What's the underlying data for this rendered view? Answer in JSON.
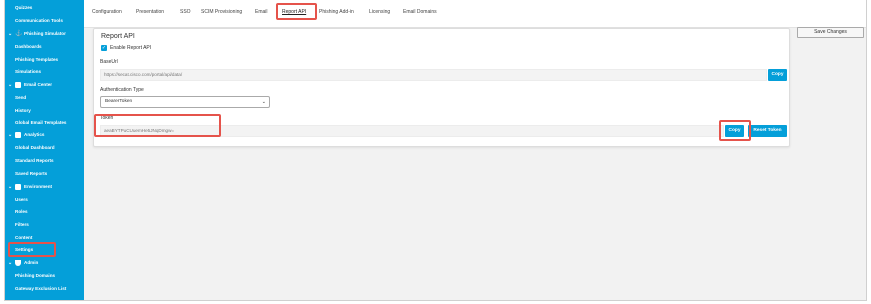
{
  "sidebar": {
    "items": [
      {
        "label": "Quizzes",
        "type": "sub"
      },
      {
        "label": "Communication Tools",
        "type": "sub"
      },
      {
        "label": "Phishing Simulator",
        "type": "group",
        "icon": "hook-icon"
      },
      {
        "label": "Dashboards",
        "type": "sub"
      },
      {
        "label": "Phishing Templates",
        "type": "sub"
      },
      {
        "label": "Simulations",
        "type": "sub"
      },
      {
        "label": "Email Center",
        "type": "group",
        "icon": "mail-icon"
      },
      {
        "label": "Send",
        "type": "sub"
      },
      {
        "label": "History",
        "type": "sub"
      },
      {
        "label": "Global Email Templates",
        "type": "sub"
      },
      {
        "label": "Analytics",
        "type": "group",
        "icon": "chart-icon"
      },
      {
        "label": "Global Dashboard",
        "type": "sub"
      },
      {
        "label": "Standard Reports",
        "type": "sub"
      },
      {
        "label": "Saved Reports",
        "type": "sub"
      },
      {
        "label": "Environment",
        "type": "group",
        "icon": "building-icon"
      },
      {
        "label": "Users",
        "type": "sub"
      },
      {
        "label": "Roles",
        "type": "sub"
      },
      {
        "label": "Filters",
        "type": "sub"
      },
      {
        "label": "Content",
        "type": "sub"
      },
      {
        "label": "Settings",
        "type": "sub"
      },
      {
        "label": "Admin",
        "type": "group",
        "icon": "shield-icon"
      },
      {
        "label": "Phishing Domains",
        "type": "sub"
      },
      {
        "label": "Gateway Exclusion List",
        "type": "sub"
      }
    ]
  },
  "tabs": [
    {
      "label": "Configuration"
    },
    {
      "label": "Presentation"
    },
    {
      "label": "SSO"
    },
    {
      "label": "SCIM Provisioning"
    },
    {
      "label": "Email"
    },
    {
      "label": "Report API"
    },
    {
      "label": "Phishing Add-in"
    },
    {
      "label": "Licensing"
    },
    {
      "label": "Email Domains"
    }
  ],
  "active_tab": "Report API",
  "toolbar": {
    "save_label": "Save Changes"
  },
  "report_api": {
    "title": "Report API",
    "enable_label": "Enable Report API",
    "enable_checked": true,
    "base_url_label": "BaseUrl",
    "base_url_value": "https://secat.cisco.com/portal/api/data/",
    "copy_label": "Copy",
    "auth_type_label": "Authentication Type",
    "auth_type_value": "BearerToken",
    "token_label": "Token",
    "token_value": "aeaBYTPuCUuemHe5JNqDmgw=",
    "token_copy_label": "Copy",
    "reset_label": "Reset Token"
  },
  "colors": {
    "accent": "#049fd9",
    "highlight": "#e5534b"
  }
}
